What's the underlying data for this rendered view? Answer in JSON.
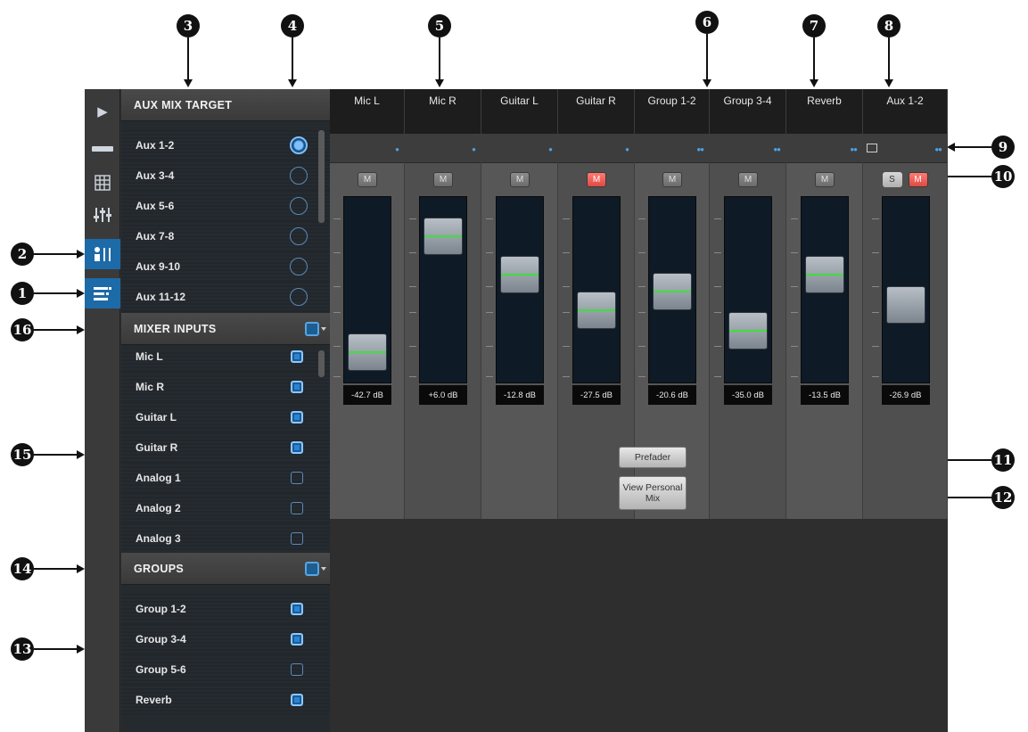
{
  "aux_mix_target": {
    "title": "AUX MIX TARGET",
    "items": [
      {
        "label": "Aux 1-2",
        "selected": true
      },
      {
        "label": "Aux 3-4",
        "selected": false
      },
      {
        "label": "Aux 5-6",
        "selected": false
      },
      {
        "label": "Aux 7-8",
        "selected": false
      },
      {
        "label": "Aux 9-10",
        "selected": false
      },
      {
        "label": "Aux 11-12",
        "selected": false
      }
    ]
  },
  "mixer_inputs": {
    "title": "MIXER INPUTS",
    "items": [
      {
        "label": "Mic L",
        "checked": true
      },
      {
        "label": "Mic R",
        "checked": true
      },
      {
        "label": "Guitar L",
        "checked": true
      },
      {
        "label": "Guitar R",
        "checked": true
      },
      {
        "label": "Analog 1",
        "checked": false
      },
      {
        "label": "Analog 2",
        "checked": false
      },
      {
        "label": "Analog 3",
        "checked": false
      }
    ]
  },
  "groups": {
    "title": "GROUPS",
    "items": [
      {
        "label": "Group 1-2",
        "checked": true
      },
      {
        "label": "Group 3-4",
        "checked": true
      },
      {
        "label": "Group 5-6",
        "checked": false
      },
      {
        "label": "Reverb",
        "checked": true
      }
    ]
  },
  "channels": [
    {
      "name": "Mic L",
      "db": "-42.7 dB",
      "muted": false,
      "fader_level": 0.08
    },
    {
      "name": "Mic R",
      "db": "+6.0 dB",
      "muted": false,
      "fader_level": 0.86
    },
    {
      "name": "Guitar L",
      "db": "-12.8 dB",
      "muted": false,
      "fader_level": 0.6
    },
    {
      "name": "Guitar R",
      "db": "-27.5 dB",
      "muted": true,
      "fader_level": 0.36
    },
    {
      "name": "Group 1-2",
      "db": "-20.6 dB",
      "muted": false,
      "fader_level": 0.49
    },
    {
      "name": "Group 3-4",
      "db": "-35.0 dB",
      "muted": false,
      "fader_level": 0.22
    },
    {
      "name": "Reverb",
      "db": "-13.5 dB",
      "muted": false,
      "fader_level": 0.6
    },
    {
      "name": "Aux 1-2",
      "db": "-26.9 dB",
      "muted": true,
      "fader_level": 0.4
    }
  ],
  "labels": {
    "mute": "M",
    "solo": "S"
  },
  "buttons": {
    "prefader": "Prefader",
    "view_personal_mix": "View Personal Mix"
  },
  "callouts": [
    "1",
    "2",
    "3",
    "4",
    "5",
    "6",
    "7",
    "8",
    "9",
    "10",
    "11",
    "12",
    "13",
    "14",
    "15",
    "16"
  ],
  "colors": {
    "accent": "#1d6aa8",
    "mute_on": "#e8544c",
    "fader_line": "#3de03d"
  }
}
